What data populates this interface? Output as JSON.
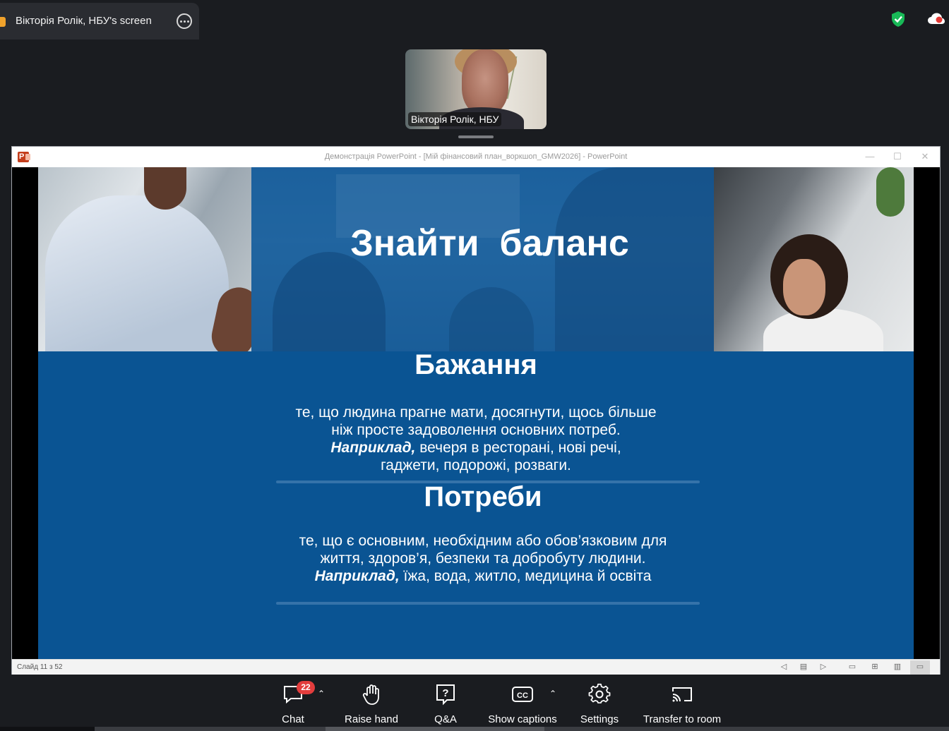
{
  "share": {
    "title": "Вікторія Ролік, НБУ's screen"
  },
  "video": {
    "participant_name": "Вікторія Ролік, НБУ"
  },
  "ppt": {
    "window_title": "Демонстрація PowerPoint - [Мій фінансовий план_воркшоп_GMW2026] - PowerPoint",
    "slide_counter": "Слайд 11 з 52"
  },
  "slide": {
    "title": "Знайти  баланс",
    "wants_heading": "Бажання",
    "wants_line1": "те, що людина прагне мати, досягнути, щось більше",
    "wants_line2": "ніж просте задоволення основних потреб.",
    "wants_example_label": "Наприклад,",
    "wants_example_text": " вечеря в ресторані, нові речі,",
    "wants_line4": "гаджети, подорожі, розваги.",
    "needs_heading": "Потреби",
    "needs_line1": "те, що є основним, необхідним або обов’язковим для",
    "needs_line2": "життя, здоров’я, безпеки та добробуту людини.",
    "needs_example_label": "Наприклад,",
    "needs_example_text": " їжа, вода, житло, медицина й освіта"
  },
  "toolbar": {
    "chat_label": "Chat",
    "chat_badge": "22",
    "raise_hand_label": "Raise hand",
    "qa_label": "Q&A",
    "captions_label": "Show captions",
    "settings_label": "Settings",
    "transfer_label": "Transfer to room"
  },
  "colors": {
    "slide_blue": "#0a5493",
    "badge_red": "#e33d3d",
    "shield_green": "#18b957",
    "app_bg": "#1a1c20"
  }
}
